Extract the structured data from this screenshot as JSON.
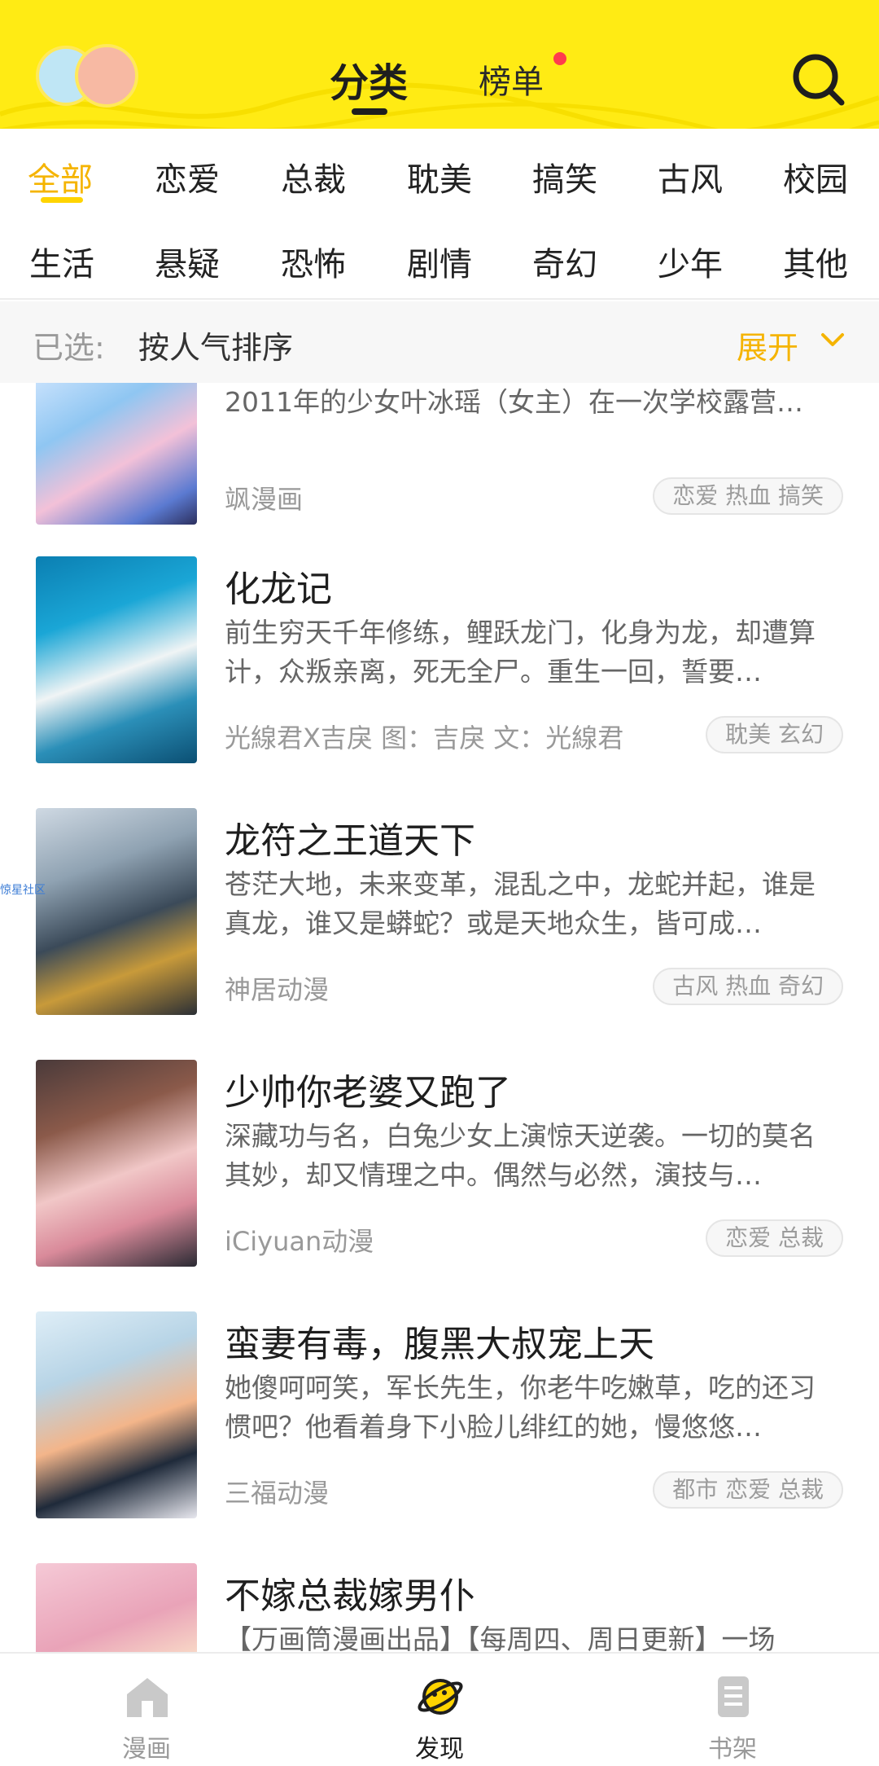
{
  "header": {
    "tabs": [
      {
        "label": "分类",
        "active": true
      },
      {
        "label": "榜单",
        "active": false,
        "has_dot": true
      }
    ],
    "search_icon": "search-icon",
    "accent_color": "#ffeb14"
  },
  "categories": {
    "row1": [
      "全部",
      "恋爱",
      "总裁",
      "耽美",
      "搞笑",
      "古风",
      "校园"
    ],
    "row2": [
      "生活",
      "悬疑",
      "恐怖",
      "剧情",
      "奇幻",
      "少年",
      "其他"
    ],
    "selected": "全部"
  },
  "filter": {
    "label": "已选:",
    "value": "按人气排序",
    "expand_label": "展开"
  },
  "comics": [
    {
      "title": "",
      "description": "2011年的少女叶冰瑶（女主）在一次学校露营…",
      "author": "飒漫画",
      "tags": "恋爱 热血 搞笑"
    },
    {
      "title": "化龙记",
      "description": "前生穷天千年修练，鲤跃龙门，化身为龙，却遭算计，众叛亲离，死无全尸。重生一回，誓要…",
      "author": "光線君X吉戾 图：吉戾 文：光線君",
      "tags": "耽美 玄幻"
    },
    {
      "title": "龙符之王道天下",
      "description": "苍茫大地，未来变革，混乱之中，龙蛇并起，谁是真龙，谁又是蟒蛇？或是天地众生，皆可成…",
      "author": "神居动漫",
      "tags": "古风 热血 奇幻"
    },
    {
      "title": "少帅你老婆又跑了",
      "description": "深藏功与名，白兔少女上演惊天逆袭。一切的莫名其妙，却又情理之中。偶然与必然，演技与…",
      "author": "iCiyuan动漫",
      "tags": "恋爱 总裁"
    },
    {
      "title": "蛮妻有毒，腹黑大叔宠上天",
      "description": "她傻呵呵笑，军长先生，你老牛吃嫩草，吃的还习惯吧？他看着身下小脸儿绯红的她，慢悠悠…",
      "author": "三福动漫",
      "tags": "都市 恋爱 总裁"
    },
    {
      "title": "不嫁总裁嫁男仆",
      "description": "【万画筒漫画出品】【每周四、周日更新】一场",
      "author": "",
      "tags": ""
    }
  ],
  "side_note": "惊星社区",
  "bottom_nav": [
    {
      "label": "漫画",
      "icon": "home-icon",
      "active": false
    },
    {
      "label": "发现",
      "icon": "planet-icon",
      "active": true
    },
    {
      "label": "书架",
      "icon": "book-icon",
      "active": false
    }
  ]
}
